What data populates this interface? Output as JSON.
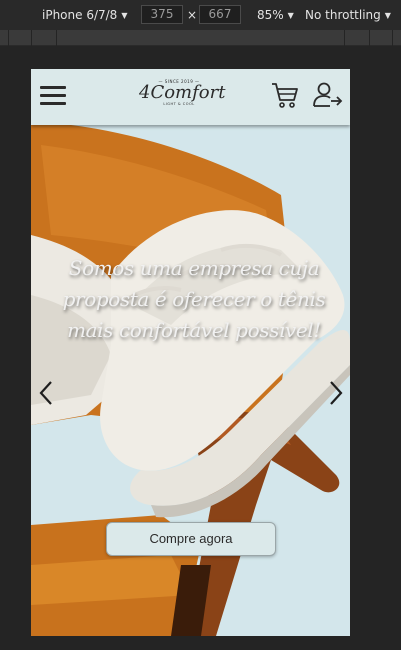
{
  "devtools": {
    "device": "iPhone 6/7/8",
    "width": "375",
    "height": "667",
    "times": "×",
    "zoom": "85%",
    "throttling": "No throttling"
  },
  "header": {
    "logo_top": "— SINCE 2019 —",
    "logo_name": "4Comfort",
    "logo_sub": "LIGHT & COOL"
  },
  "hero": {
    "headline": "Somos uma empresa cuja proposta é oferecer o tênis mais confortável possível!",
    "cta_label": "Compre agora"
  },
  "icons": [
    "hamburger-menu-icon",
    "cart-icon",
    "user-login-icon",
    "chevron-left-icon",
    "chevron-right-icon",
    "caret-down-icon"
  ]
}
